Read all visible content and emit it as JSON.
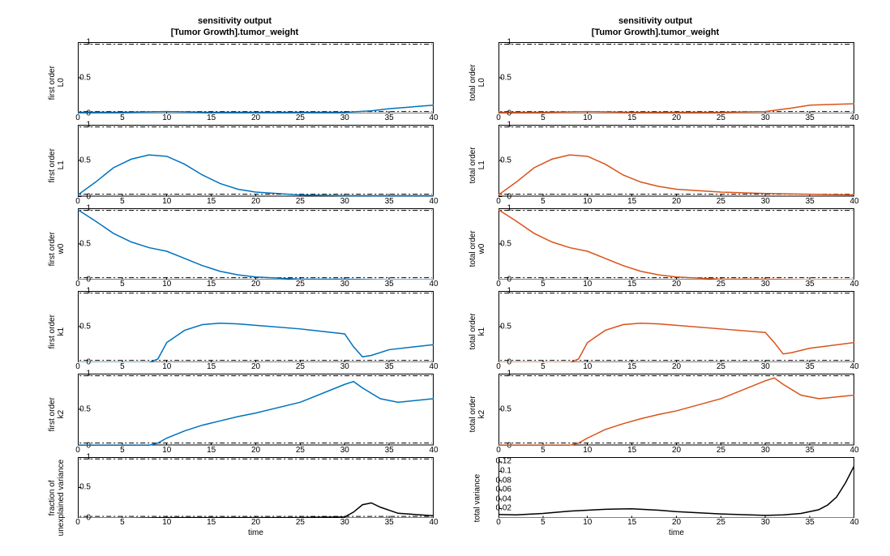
{
  "left_title_line1": "sensitivity output",
  "left_title_line2": "[Tumor Growth].tumor_weight",
  "right_title_line1": "sensitivity output",
  "right_title_line2": "[Tumor Growth].tumor_weight",
  "xlabel": "time",
  "panels_left": [
    {
      "ylabel": "first order\nL0",
      "kind": "std01"
    },
    {
      "ylabel": "first order\nL1",
      "kind": "std01"
    },
    {
      "ylabel": "first order\nw0",
      "kind": "std01"
    },
    {
      "ylabel": "first order\nk1",
      "kind": "std01"
    },
    {
      "ylabel": "first order\nk2",
      "kind": "std01"
    },
    {
      "ylabel": "fraction of\nunexplained variance",
      "kind": "std01"
    }
  ],
  "panels_right": [
    {
      "ylabel": "total order\nL0",
      "kind": "std01"
    },
    {
      "ylabel": "total order\nL1",
      "kind": "std01"
    },
    {
      "ylabel": "total order\nw0",
      "kind": "std01"
    },
    {
      "ylabel": "total order\nk1",
      "kind": "std01"
    },
    {
      "ylabel": "total order\nk2",
      "kind": "std01"
    },
    {
      "ylabel": "total variance",
      "kind": "variance"
    }
  ],
  "xticks": [
    0,
    5,
    10,
    15,
    20,
    25,
    30,
    35,
    40
  ],
  "yticks_std": [
    0,
    0.5,
    1
  ],
  "yticks_variance": [
    0.02,
    0.04,
    0.06,
    0.08,
    0.1,
    0.12
  ],
  "chart_data": [
    {
      "column": "left",
      "color": "#0072BD",
      "title": "sensitivity output [Tumor Growth].tumor_weight",
      "xlabel": "time",
      "xlim": [
        0,
        40
      ],
      "panels": [
        {
          "type": "line",
          "ylabel": "first order L0",
          "ylim": [
            0,
            1
          ],
          "x": [
            0,
            5,
            10,
            15,
            20,
            25,
            30,
            33,
            35,
            40
          ],
          "values": [
            0.02,
            0.02,
            0.03,
            0.02,
            0.02,
            0.02,
            0.02,
            0.04,
            0.07,
            0.12
          ]
        },
        {
          "type": "line",
          "ylabel": "first order L1",
          "ylim": [
            0,
            1
          ],
          "x": [
            0,
            2,
            4,
            6,
            8,
            10,
            12,
            14,
            16,
            18,
            20,
            25,
            30,
            35,
            40
          ],
          "values": [
            0.02,
            0.2,
            0.4,
            0.52,
            0.58,
            0.56,
            0.45,
            0.3,
            0.18,
            0.1,
            0.06,
            0.02,
            0.01,
            0.01,
            0.01
          ]
        },
        {
          "type": "line",
          "ylabel": "first order w0",
          "ylim": [
            0,
            1
          ],
          "x": [
            0,
            2,
            4,
            6,
            8,
            10,
            12,
            14,
            16,
            18,
            20,
            25,
            30,
            35,
            40
          ],
          "values": [
            0.98,
            0.82,
            0.65,
            0.53,
            0.45,
            0.4,
            0.3,
            0.2,
            0.12,
            0.07,
            0.04,
            0.01,
            0.01,
            0.0,
            0.0
          ]
        },
        {
          "type": "line",
          "ylabel": "first order k1",
          "ylim": [
            0,
            1
          ],
          "x": [
            0,
            5,
            8,
            9,
            10,
            12,
            14,
            16,
            18,
            20,
            25,
            30,
            31,
            32,
            33,
            35,
            40
          ],
          "values": [
            0.0,
            0.0,
            0.0,
            0.05,
            0.28,
            0.45,
            0.53,
            0.55,
            0.54,
            0.52,
            0.47,
            0.4,
            0.22,
            0.08,
            0.1,
            0.18,
            0.25
          ]
        },
        {
          "type": "line",
          "ylabel": "first order k2",
          "ylim": [
            0,
            1
          ],
          "x": [
            0,
            5,
            8,
            9,
            10,
            12,
            14,
            16,
            18,
            20,
            25,
            30,
            31,
            32,
            34,
            36,
            40
          ],
          "values": [
            0.0,
            0.0,
            0.0,
            0.03,
            0.1,
            0.2,
            0.28,
            0.34,
            0.4,
            0.45,
            0.6,
            0.85,
            0.89,
            0.8,
            0.65,
            0.6,
            0.65
          ]
        },
        {
          "type": "line",
          "ylabel": "fraction of unexplained variance",
          "ylim": [
            0,
            1
          ],
          "color": "#000",
          "x": [
            0,
            5,
            10,
            15,
            20,
            25,
            30,
            31,
            32,
            33,
            34,
            36,
            40
          ],
          "values": [
            0.0,
            0.0,
            0.01,
            0.01,
            0.01,
            0.01,
            0.02,
            0.1,
            0.22,
            0.25,
            0.18,
            0.08,
            0.04
          ]
        }
      ]
    },
    {
      "column": "right",
      "color": "#D95319",
      "title": "sensitivity output [Tumor Growth].tumor_weight",
      "xlabel": "time",
      "xlim": [
        0,
        40
      ],
      "panels": [
        {
          "type": "line",
          "ylabel": "total order L0",
          "ylim": [
            0,
            1
          ],
          "x": [
            0,
            5,
            10,
            15,
            20,
            25,
            30,
            33,
            35,
            40
          ],
          "values": [
            0.02,
            0.02,
            0.03,
            0.02,
            0.02,
            0.02,
            0.03,
            0.08,
            0.12,
            0.14
          ]
        },
        {
          "type": "line",
          "ylabel": "total order L1",
          "ylim": [
            0,
            1
          ],
          "x": [
            0,
            2,
            4,
            6,
            8,
            10,
            12,
            14,
            16,
            18,
            20,
            25,
            30,
            35,
            40
          ],
          "values": [
            0.02,
            0.2,
            0.4,
            0.52,
            0.58,
            0.56,
            0.45,
            0.3,
            0.2,
            0.14,
            0.1,
            0.06,
            0.04,
            0.03,
            0.02
          ]
        },
        {
          "type": "line",
          "ylabel": "total order w0",
          "ylim": [
            0,
            1
          ],
          "x": [
            0,
            2,
            4,
            6,
            8,
            10,
            12,
            14,
            16,
            18,
            20,
            25,
            30,
            35,
            40
          ],
          "values": [
            0.98,
            0.82,
            0.65,
            0.53,
            0.45,
            0.4,
            0.3,
            0.2,
            0.12,
            0.07,
            0.04,
            0.01,
            0.01,
            0.0,
            0.0
          ]
        },
        {
          "type": "line",
          "ylabel": "total order k1",
          "ylim": [
            0,
            1
          ],
          "x": [
            0,
            5,
            8,
            9,
            10,
            12,
            14,
            16,
            18,
            20,
            25,
            30,
            31,
            32,
            33,
            35,
            40
          ],
          "values": [
            0.0,
            0.0,
            0.0,
            0.05,
            0.28,
            0.45,
            0.53,
            0.55,
            0.54,
            0.52,
            0.47,
            0.42,
            0.28,
            0.12,
            0.14,
            0.2,
            0.28
          ]
        },
        {
          "type": "line",
          "ylabel": "total order k2",
          "ylim": [
            0,
            1
          ],
          "x": [
            0,
            5,
            8,
            9,
            10,
            12,
            14,
            16,
            18,
            20,
            25,
            30,
            31,
            32,
            34,
            36,
            40
          ],
          "values": [
            0.0,
            0.0,
            0.0,
            0.03,
            0.1,
            0.22,
            0.3,
            0.37,
            0.43,
            0.48,
            0.65,
            0.9,
            0.94,
            0.85,
            0.7,
            0.65,
            0.7
          ]
        },
        {
          "type": "line",
          "ylabel": "total variance",
          "ylim": [
            0,
            0.13
          ],
          "color": "#000",
          "x": [
            0,
            2,
            5,
            8,
            10,
            12,
            15,
            18,
            20,
            25,
            30,
            32,
            34,
            36,
            37,
            38,
            39,
            40
          ],
          "values": [
            0.008,
            0.007,
            0.01,
            0.015,
            0.017,
            0.019,
            0.02,
            0.017,
            0.014,
            0.009,
            0.006,
            0.007,
            0.01,
            0.018,
            0.028,
            0.045,
            0.075,
            0.112
          ]
        }
      ]
    }
  ]
}
